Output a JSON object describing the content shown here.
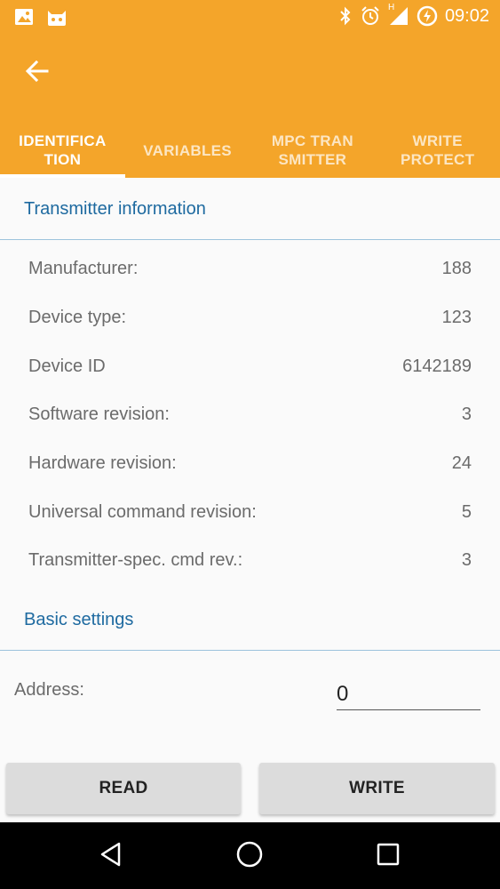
{
  "status_bar": {
    "time": "09:02",
    "network_label": "H",
    "icons_left": [
      "image-icon",
      "cat-icon"
    ],
    "icons_right": [
      "bluetooth-icon",
      "alarm-icon",
      "signal-icon",
      "battery-charging-icon"
    ]
  },
  "app_bar": {
    "back_icon": "arrow-left-icon",
    "tabs": [
      {
        "label": "IDENTIFICA\nTION",
        "active": true
      },
      {
        "label": "VARIABLES",
        "active": false
      },
      {
        "label": "MPC TRAN\nSMITTER",
        "active": false
      },
      {
        "label": "WRITE\nPROTECT",
        "active": false
      }
    ]
  },
  "transmitter_section": {
    "title": "Transmitter information",
    "rows": [
      {
        "label": "Manufacturer:",
        "value": "188"
      },
      {
        "label": "Device type:",
        "value": "123"
      },
      {
        "label": "Device ID",
        "value": "6142189"
      },
      {
        "label": "Software revision:",
        "value": "3"
      },
      {
        "label": "Hardware revision:",
        "value": "24"
      },
      {
        "label": "Universal command revision:",
        "value": "5"
      },
      {
        "label": "Transmitter-spec. cmd rev.:",
        "value": "3"
      }
    ]
  },
  "basic_section": {
    "title": "Basic settings",
    "address_label": "Address:",
    "address_value": "0"
  },
  "buttons": {
    "read_label": "READ",
    "write_label": "WRITE"
  },
  "nav_bar": {
    "icons": [
      "back-triangle-icon",
      "home-circle-icon",
      "recents-square-icon"
    ]
  },
  "colors": {
    "accent": "#f4a52a",
    "section_title": "#1e6aa0",
    "divider": "#9cc3dc"
  }
}
